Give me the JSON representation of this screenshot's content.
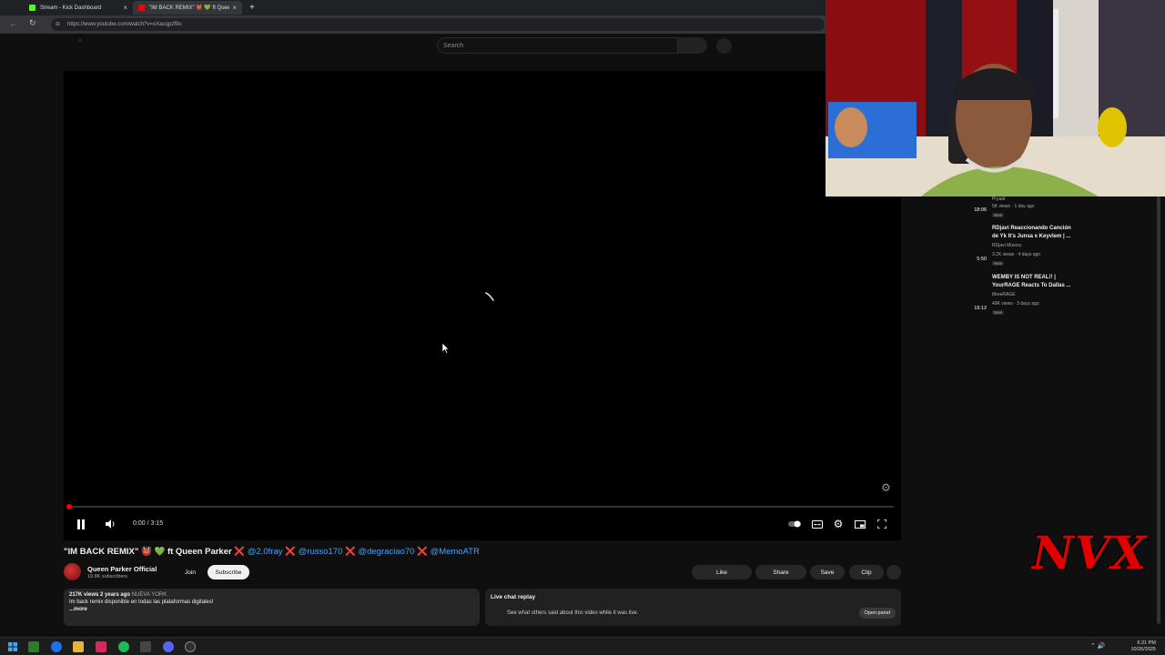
{
  "browser": {
    "tabs": [
      {
        "label": "Stream - Kick Dashboard",
        "active": false,
        "favicon_color": "#53fc18"
      },
      {
        "label": "\"IM BACK REMIX\" 👹 💚 ft Queen",
        "active": true,
        "favicon_color": "#ff0000"
      }
    ],
    "new_tab_label": "+",
    "url": "https://www.youtube.com/watch?v=oXacqpzf9o"
  },
  "header": {
    "search_placeholder": "Search"
  },
  "player": {
    "time": "0:00 / 3:15",
    "progress_fraction": 0.0,
    "state": "playing",
    "controls": {
      "pause_icon": "❚❚",
      "volume_icon": "🔈",
      "settings_icon": "⚙",
      "fullscreen_icon": "⛶"
    }
  },
  "video": {
    "title_prefix": "\"IM BACK REMIX\" 👹 💚 ft Queen Parker",
    "mentions": [
      "@2.0fray",
      "@russo170",
      "@degraciao70",
      "@MemoATR"
    ],
    "separator": "❌",
    "channel_name": "Queen Parker Official",
    "subscribers": "19.8K subscribers",
    "join_label": "Join",
    "subscribe_label": "Subscribe",
    "like_label": "Like",
    "share_label": "Share",
    "save_label": "Save",
    "clip_label": "Clip"
  },
  "description": {
    "views": "217K views",
    "age": "2 years ago",
    "location": "NUEVA YORK",
    "text": "Im back remix disponible en todas las plataformas digitales!",
    "more": "...more"
  },
  "live_chat": {
    "title": "Live chat replay",
    "subtitle": "See what others said about this video while it was live.",
    "open_panel": "Open panel"
  },
  "recommendations": [
    {
      "duration": "18:06",
      "title_lines": [
        "",
        ""
      ],
      "channel": "Pryaat",
      "stats": "5K views · 1 day ago",
      "badge": "New"
    },
    {
      "duration": "5:50",
      "title_lines": [
        "RDjavi Reaccionando Canción",
        "de Yk It's Junsa x Keyvlem | ..."
      ],
      "channel": "RDjavi Música",
      "stats": "3.2K views · 4 days ago",
      "badge": "New"
    },
    {
      "duration": "19:12",
      "title_lines": [
        "WEMBY IS NOT REAL!! |",
        "YourRAGE Reacts To Dallas ..."
      ],
      "channel": "MoreRAGE",
      "stats": "49K views · 3 days ago",
      "badge": "New"
    }
  ],
  "overlay": {
    "logo_text": "NVX"
  },
  "taskbar": {
    "time": "6:21 PM",
    "date": "10/26/2025"
  },
  "colors": {
    "youtube_red": "#ff0000",
    "link_blue": "#3ea6ff",
    "background": "#0f0f0f",
    "nvx_red": "#e00000"
  }
}
